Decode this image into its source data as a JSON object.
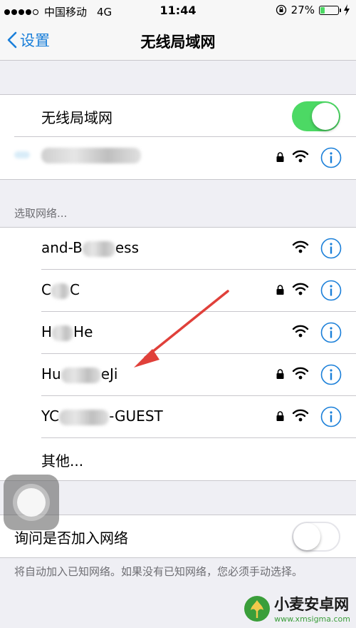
{
  "status_bar": {
    "carrier": "中国移动",
    "network": "4G",
    "time": "11:44",
    "battery_text": "27%",
    "battery_level": 0.27
  },
  "nav": {
    "back_label": "设置",
    "title": "无线局域网"
  },
  "wifi_toggle": {
    "label": "无线局域网",
    "state": "on"
  },
  "connected_network": {
    "secured": true
  },
  "section_header": "选取网络...",
  "networks": [
    {
      "prefix": "and-B",
      "suffix": "ess",
      "secured": false
    },
    {
      "prefix": "C",
      "suffix": "C",
      "secured": true
    },
    {
      "prefix": "H",
      "suffix": "He",
      "secured": false
    },
    {
      "prefix": "Hu",
      "suffix": "eJi",
      "secured": true
    },
    {
      "prefix": "YC",
      "suffix": "-GUEST",
      "secured": true
    }
  ],
  "other_label": "其他...",
  "ask_to_join": {
    "label": "询问是否加入网络",
    "state": "off"
  },
  "footer_note": "将自动加入已知网络。如果没有已知网络，您必须手动选择。",
  "watermark": {
    "title": "小麦安卓网",
    "url": "www.xmsigma.com"
  },
  "colors": {
    "accent": "#1a7fd9",
    "toggle_on": "#4cd964",
    "annotation_arrow": "#e0403a"
  }
}
